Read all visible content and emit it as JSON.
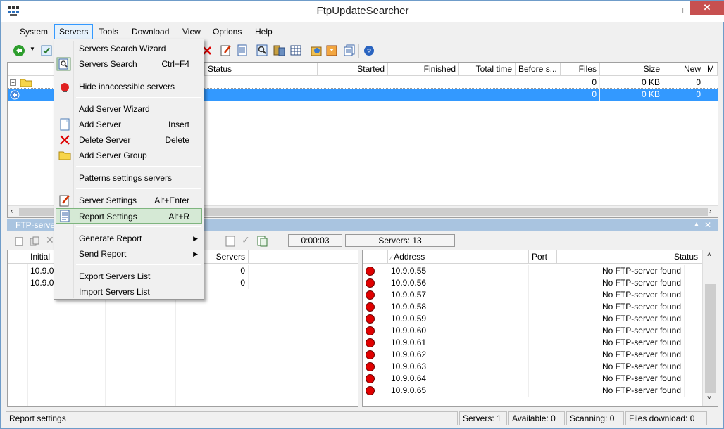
{
  "window": {
    "title": "FtpUpdateSearcher"
  },
  "menubar": [
    "System",
    "Servers",
    "Tools",
    "Download",
    "View",
    "Options",
    "Help"
  ],
  "servers_grid": {
    "headers": [
      "Status",
      "Started",
      "Finished",
      "Total time",
      "Before s...",
      "Files",
      "Size",
      "New",
      "M"
    ],
    "rows": [
      {
        "files": "0",
        "size": "0 KB",
        "new": "0"
      },
      {
        "files": "0",
        "size": "0 KB",
        "new": "0"
      }
    ]
  },
  "ftp_panel": {
    "title": "FTP-server",
    "timer": "0:00:03",
    "servers_count": "Servers: 13"
  },
  "left_grid": {
    "headers": [
      "Initial",
      "Servers"
    ],
    "rows": [
      {
        "initial": "10.9.0.",
        "servers": "0"
      },
      {
        "initial": "10.9.0.",
        "servers": "0"
      }
    ]
  },
  "right_grid": {
    "headers": [
      "Address",
      "Port",
      "Status"
    ],
    "rows": [
      {
        "address": "10.9.0.55",
        "status": "No FTP-server found"
      },
      {
        "address": "10.9.0.56",
        "status": "No FTP-server found"
      },
      {
        "address": "10.9.0.57",
        "status": "No FTP-server found"
      },
      {
        "address": "10.9.0.58",
        "status": "No FTP-server found"
      },
      {
        "address": "10.9.0.59",
        "status": "No FTP-server found"
      },
      {
        "address": "10.9.0.60",
        "status": "No FTP-server found"
      },
      {
        "address": "10.9.0.61",
        "status": "No FTP-server found"
      },
      {
        "address": "10.9.0.62",
        "status": "No FTP-server found"
      },
      {
        "address": "10.9.0.63",
        "status": "No FTP-server found"
      },
      {
        "address": "10.9.0.64",
        "status": "No FTP-server found"
      },
      {
        "address": "10.9.0.65",
        "status": "No FTP-server found"
      }
    ]
  },
  "servers_menu": {
    "items": [
      {
        "label": "Servers Search Wizard",
        "shortcut": ""
      },
      {
        "label": "Servers Search",
        "shortcut": "Ctrl+F4"
      },
      {
        "label": "Hide inaccessible servers",
        "shortcut": ""
      },
      {
        "label": "Add Server Wizard",
        "shortcut": ""
      },
      {
        "label": "Add Server",
        "shortcut": "Insert"
      },
      {
        "label": "Delete Server",
        "shortcut": "Delete"
      },
      {
        "label": "Add Server Group",
        "shortcut": ""
      },
      {
        "label": "Patterns settings servers",
        "shortcut": ""
      },
      {
        "label": "Server Settings",
        "shortcut": "Alt+Enter"
      },
      {
        "label": "Report Settings",
        "shortcut": "Alt+R"
      },
      {
        "label": "Generate Report",
        "shortcut": ""
      },
      {
        "label": "Send Report",
        "shortcut": ""
      },
      {
        "label": "Export Servers List",
        "shortcut": ""
      },
      {
        "label": "Import Servers List",
        "shortcut": ""
      }
    ]
  },
  "statusbar": {
    "hint": "Report settings",
    "servers": "Servers: 1",
    "available": "Available: 0",
    "scanning": "Scanning: 0",
    "files_download": "Files download: 0"
  },
  "colors": {
    "selection": "#3399ff",
    "menu_highlight": "#d5e9d5",
    "status_dot": "#e00000"
  }
}
